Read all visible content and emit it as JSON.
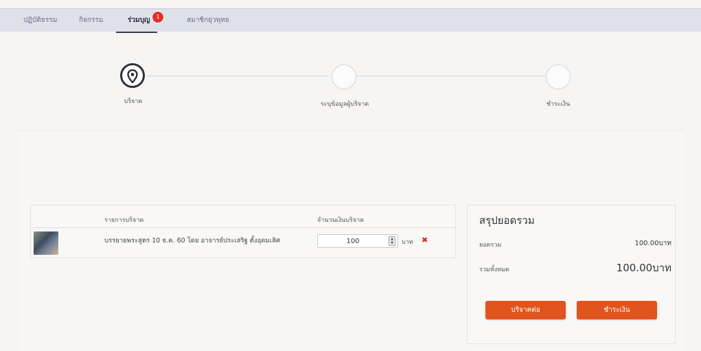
{
  "nav": {
    "items": [
      {
        "label": "ปฏิบัติธรรม"
      },
      {
        "label": "กิจกรรม"
      },
      {
        "label": "ร่วมบุญ",
        "badge": "1"
      },
      {
        "label": "สมาชิกยุวพุทธ"
      }
    ]
  },
  "stepper": {
    "steps": [
      {
        "label": "บริจาค"
      },
      {
        "label": "ระบุข้อมูลผู้บริจาค"
      },
      {
        "label": "ชำระเงิน"
      }
    ]
  },
  "table": {
    "headers": {
      "item": "รายการบริจาค",
      "amount": "จำนวนเงินบริจาค"
    },
    "rows": [
      {
        "name": "บรรยายพระสูตร 10 ธ.ค. 60 โดย อาจารย์ประเสริฐ ตั้งอุดมเลิศ",
        "amount": "100",
        "unit": "บาท",
        "remove_symbol": "✖"
      }
    ]
  },
  "summary": {
    "title": "สรุปยอดรวม",
    "subtotal_label": "ยอดรวม",
    "subtotal_value": "100.00บาท",
    "total_label": "รวมทั้งหมด",
    "total_value": "100.00บาท",
    "continue_button": "บริจาคต่อ",
    "pay_button": "ชำระเงิน"
  },
  "colors": {
    "accent": "#e2541d",
    "nav_bg": "#dfe1ea",
    "badge": "#e0312a"
  }
}
